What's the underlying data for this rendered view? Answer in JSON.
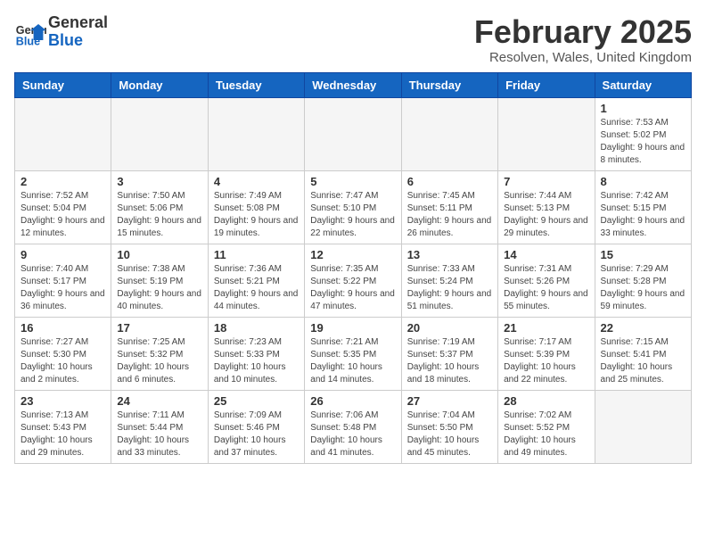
{
  "header": {
    "logo_line1": "General",
    "logo_line2": "Blue",
    "month": "February 2025",
    "location": "Resolven, Wales, United Kingdom"
  },
  "weekdays": [
    "Sunday",
    "Monday",
    "Tuesday",
    "Wednesday",
    "Thursday",
    "Friday",
    "Saturday"
  ],
  "weeks": [
    [
      {
        "day": "",
        "info": ""
      },
      {
        "day": "",
        "info": ""
      },
      {
        "day": "",
        "info": ""
      },
      {
        "day": "",
        "info": ""
      },
      {
        "day": "",
        "info": ""
      },
      {
        "day": "",
        "info": ""
      },
      {
        "day": "1",
        "info": "Sunrise: 7:53 AM\nSunset: 5:02 PM\nDaylight: 9 hours and 8 minutes."
      }
    ],
    [
      {
        "day": "2",
        "info": "Sunrise: 7:52 AM\nSunset: 5:04 PM\nDaylight: 9 hours and 12 minutes."
      },
      {
        "day": "3",
        "info": "Sunrise: 7:50 AM\nSunset: 5:06 PM\nDaylight: 9 hours and 15 minutes."
      },
      {
        "day": "4",
        "info": "Sunrise: 7:49 AM\nSunset: 5:08 PM\nDaylight: 9 hours and 19 minutes."
      },
      {
        "day": "5",
        "info": "Sunrise: 7:47 AM\nSunset: 5:10 PM\nDaylight: 9 hours and 22 minutes."
      },
      {
        "day": "6",
        "info": "Sunrise: 7:45 AM\nSunset: 5:11 PM\nDaylight: 9 hours and 26 minutes."
      },
      {
        "day": "7",
        "info": "Sunrise: 7:44 AM\nSunset: 5:13 PM\nDaylight: 9 hours and 29 minutes."
      },
      {
        "day": "8",
        "info": "Sunrise: 7:42 AM\nSunset: 5:15 PM\nDaylight: 9 hours and 33 minutes."
      }
    ],
    [
      {
        "day": "9",
        "info": "Sunrise: 7:40 AM\nSunset: 5:17 PM\nDaylight: 9 hours and 36 minutes."
      },
      {
        "day": "10",
        "info": "Sunrise: 7:38 AM\nSunset: 5:19 PM\nDaylight: 9 hours and 40 minutes."
      },
      {
        "day": "11",
        "info": "Sunrise: 7:36 AM\nSunset: 5:21 PM\nDaylight: 9 hours and 44 minutes."
      },
      {
        "day": "12",
        "info": "Sunrise: 7:35 AM\nSunset: 5:22 PM\nDaylight: 9 hours and 47 minutes."
      },
      {
        "day": "13",
        "info": "Sunrise: 7:33 AM\nSunset: 5:24 PM\nDaylight: 9 hours and 51 minutes."
      },
      {
        "day": "14",
        "info": "Sunrise: 7:31 AM\nSunset: 5:26 PM\nDaylight: 9 hours and 55 minutes."
      },
      {
        "day": "15",
        "info": "Sunrise: 7:29 AM\nSunset: 5:28 PM\nDaylight: 9 hours and 59 minutes."
      }
    ],
    [
      {
        "day": "16",
        "info": "Sunrise: 7:27 AM\nSunset: 5:30 PM\nDaylight: 10 hours and 2 minutes."
      },
      {
        "day": "17",
        "info": "Sunrise: 7:25 AM\nSunset: 5:32 PM\nDaylight: 10 hours and 6 minutes."
      },
      {
        "day": "18",
        "info": "Sunrise: 7:23 AM\nSunset: 5:33 PM\nDaylight: 10 hours and 10 minutes."
      },
      {
        "day": "19",
        "info": "Sunrise: 7:21 AM\nSunset: 5:35 PM\nDaylight: 10 hours and 14 minutes."
      },
      {
        "day": "20",
        "info": "Sunrise: 7:19 AM\nSunset: 5:37 PM\nDaylight: 10 hours and 18 minutes."
      },
      {
        "day": "21",
        "info": "Sunrise: 7:17 AM\nSunset: 5:39 PM\nDaylight: 10 hours and 22 minutes."
      },
      {
        "day": "22",
        "info": "Sunrise: 7:15 AM\nSunset: 5:41 PM\nDaylight: 10 hours and 25 minutes."
      }
    ],
    [
      {
        "day": "23",
        "info": "Sunrise: 7:13 AM\nSunset: 5:43 PM\nDaylight: 10 hours and 29 minutes."
      },
      {
        "day": "24",
        "info": "Sunrise: 7:11 AM\nSunset: 5:44 PM\nDaylight: 10 hours and 33 minutes."
      },
      {
        "day": "25",
        "info": "Sunrise: 7:09 AM\nSunset: 5:46 PM\nDaylight: 10 hours and 37 minutes."
      },
      {
        "day": "26",
        "info": "Sunrise: 7:06 AM\nSunset: 5:48 PM\nDaylight: 10 hours and 41 minutes."
      },
      {
        "day": "27",
        "info": "Sunrise: 7:04 AM\nSunset: 5:50 PM\nDaylight: 10 hours and 45 minutes."
      },
      {
        "day": "28",
        "info": "Sunrise: 7:02 AM\nSunset: 5:52 PM\nDaylight: 10 hours and 49 minutes."
      },
      {
        "day": "",
        "info": ""
      }
    ]
  ]
}
